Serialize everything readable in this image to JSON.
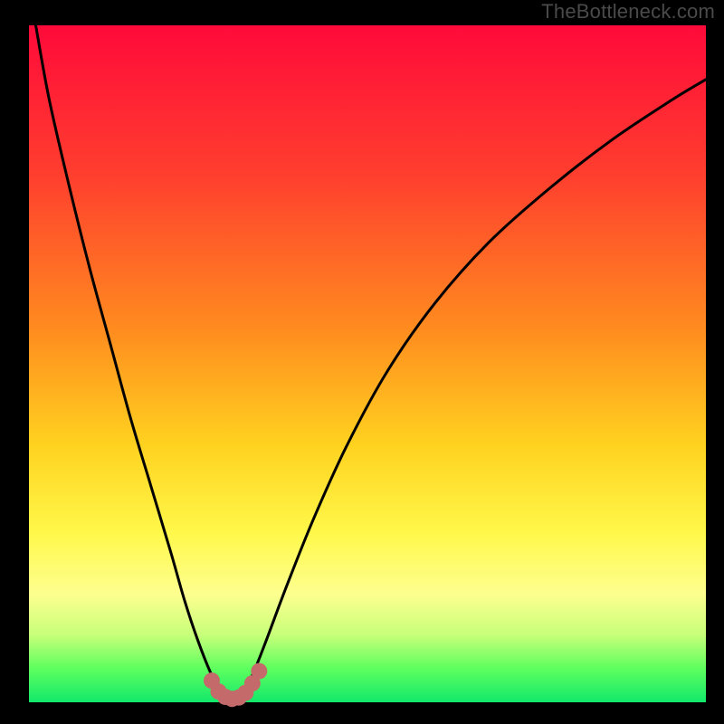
{
  "watermark": "TheBottleneck.com",
  "chart_data": {
    "type": "line",
    "title": "",
    "xlabel": "",
    "ylabel": "",
    "xlim": [
      0,
      100
    ],
    "ylim": [
      0,
      100
    ],
    "gradient_stops": [
      {
        "offset": 0,
        "color": "#ff0a3a"
      },
      {
        "offset": 22,
        "color": "#ff3e2e"
      },
      {
        "offset": 45,
        "color": "#ff8c1f"
      },
      {
        "offset": 62,
        "color": "#ffd21f"
      },
      {
        "offset": 75,
        "color": "#fff84a"
      },
      {
        "offset": 84,
        "color": "#fdff8f"
      },
      {
        "offset": 90,
        "color": "#c8ff7a"
      },
      {
        "offset": 95,
        "color": "#5eff5e"
      },
      {
        "offset": 100,
        "color": "#12e86b"
      }
    ],
    "series": [
      {
        "name": "bottleneck-curve",
        "x": [
          1,
          3,
          6,
          9,
          12,
          15,
          18,
          21,
          23,
          25,
          27,
          28.5,
          30,
          31.5,
          33,
          35,
          38,
          42,
          47,
          53,
          60,
          68,
          77,
          86,
          95,
          100
        ],
        "y": [
          100,
          89,
          76,
          64,
          53,
          42,
          32,
          22,
          15,
          9,
          4,
          1.5,
          0.5,
          1.5,
          4,
          9,
          17,
          27,
          38,
          49,
          59,
          68,
          76,
          83,
          89,
          92
        ]
      }
    ],
    "markers": {
      "name": "optimum-band",
      "color": "#c56a6a",
      "radius": 1.2,
      "points": [
        {
          "x": 27.0,
          "y": 3.2
        },
        {
          "x": 28.0,
          "y": 1.6
        },
        {
          "x": 29.0,
          "y": 0.8
        },
        {
          "x": 30.0,
          "y": 0.5
        },
        {
          "x": 31.0,
          "y": 0.7
        },
        {
          "x": 32.0,
          "y": 1.4
        },
        {
          "x": 33.0,
          "y": 2.8
        },
        {
          "x": 34.0,
          "y": 4.6
        }
      ]
    }
  }
}
